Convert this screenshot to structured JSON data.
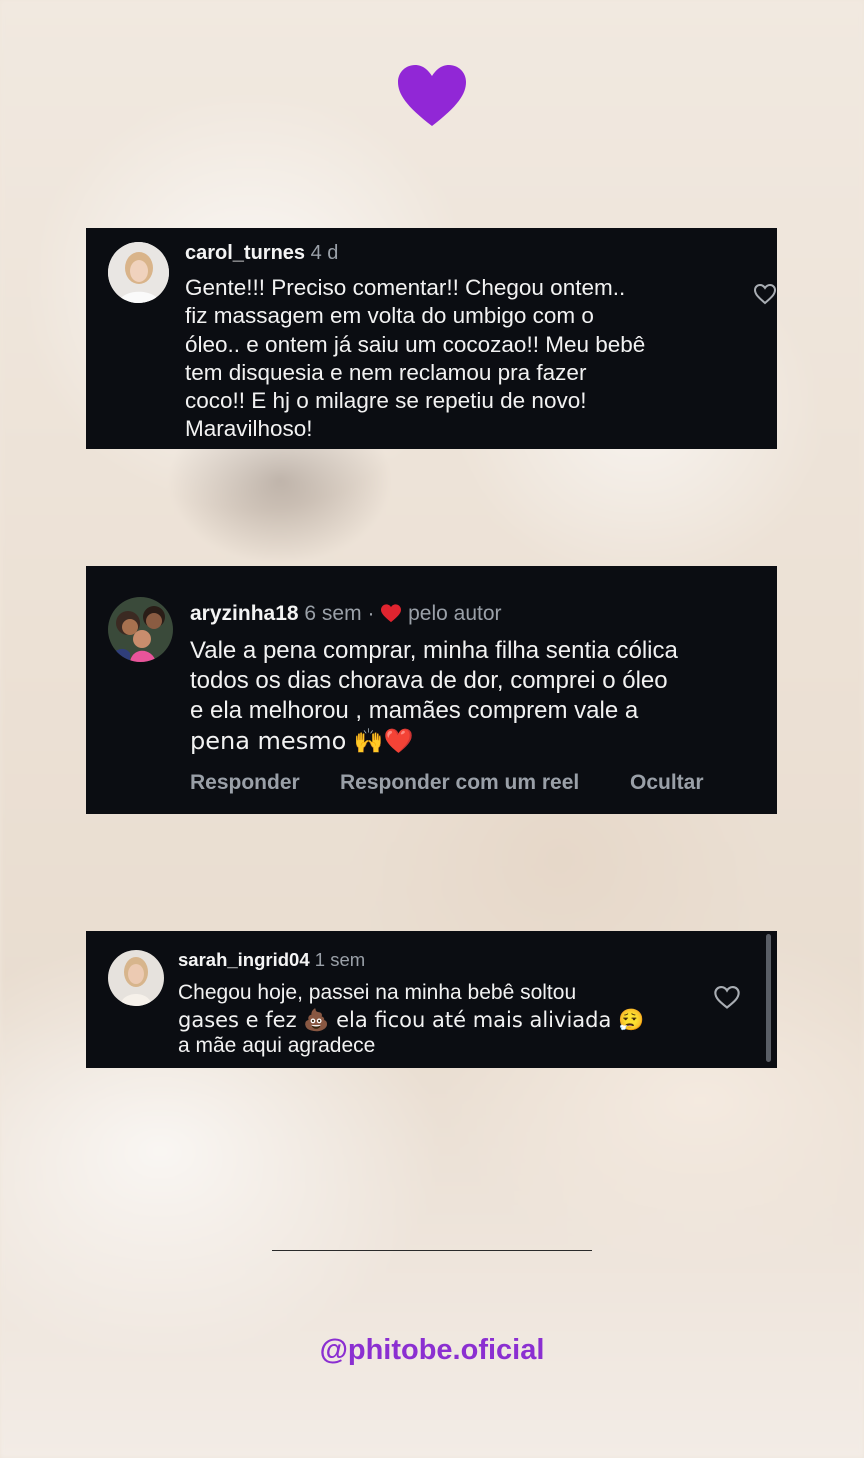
{
  "colors": {
    "accent": "#8b2fd1",
    "card_bg": "#0b0d12",
    "author_heart": "#e0242f"
  },
  "top_icon": "purple-heart-icon",
  "comments": [
    {
      "username": "carol_turnes",
      "time": "4 d",
      "text_lines": [
        "Gente!!! Preciso comentar!! Chegou ontem..",
        "fiz massagem em volta do umbigo com o",
        "óleo.. e ontem já saiu um cocozao!! Meu bebê",
        "tem disquesia e nem reclamou pra fazer",
        "coco!! E hj o milagre se repetiu de novo!",
        "Maravilhoso!"
      ]
    },
    {
      "username": "aryzinha18",
      "time": "6 sem",
      "separator": "·",
      "liked_by_author": "pelo autor",
      "text_lines": [
        "Vale a pena comprar, minha filha sentia cólica",
        "todos os dias chorava de dor, comprei o óleo",
        "e ela melhorou , mamães comprem vale a",
        "pena mesmo 🙌❤️"
      ],
      "actions": [
        "Responder",
        "Responder com um reel",
        "Ocultar"
      ]
    },
    {
      "username": "sarah_ingrid04",
      "time": "1 sem",
      "text_lines": [
        "Chegou hoje, passei na minha bebê soltou",
        "gases e fez 💩 ela ficou até mais aliviada 😮‍💨",
        "a mãe aqui agradece"
      ]
    }
  ],
  "footer": {
    "handle": "@phitobe.oficial"
  }
}
